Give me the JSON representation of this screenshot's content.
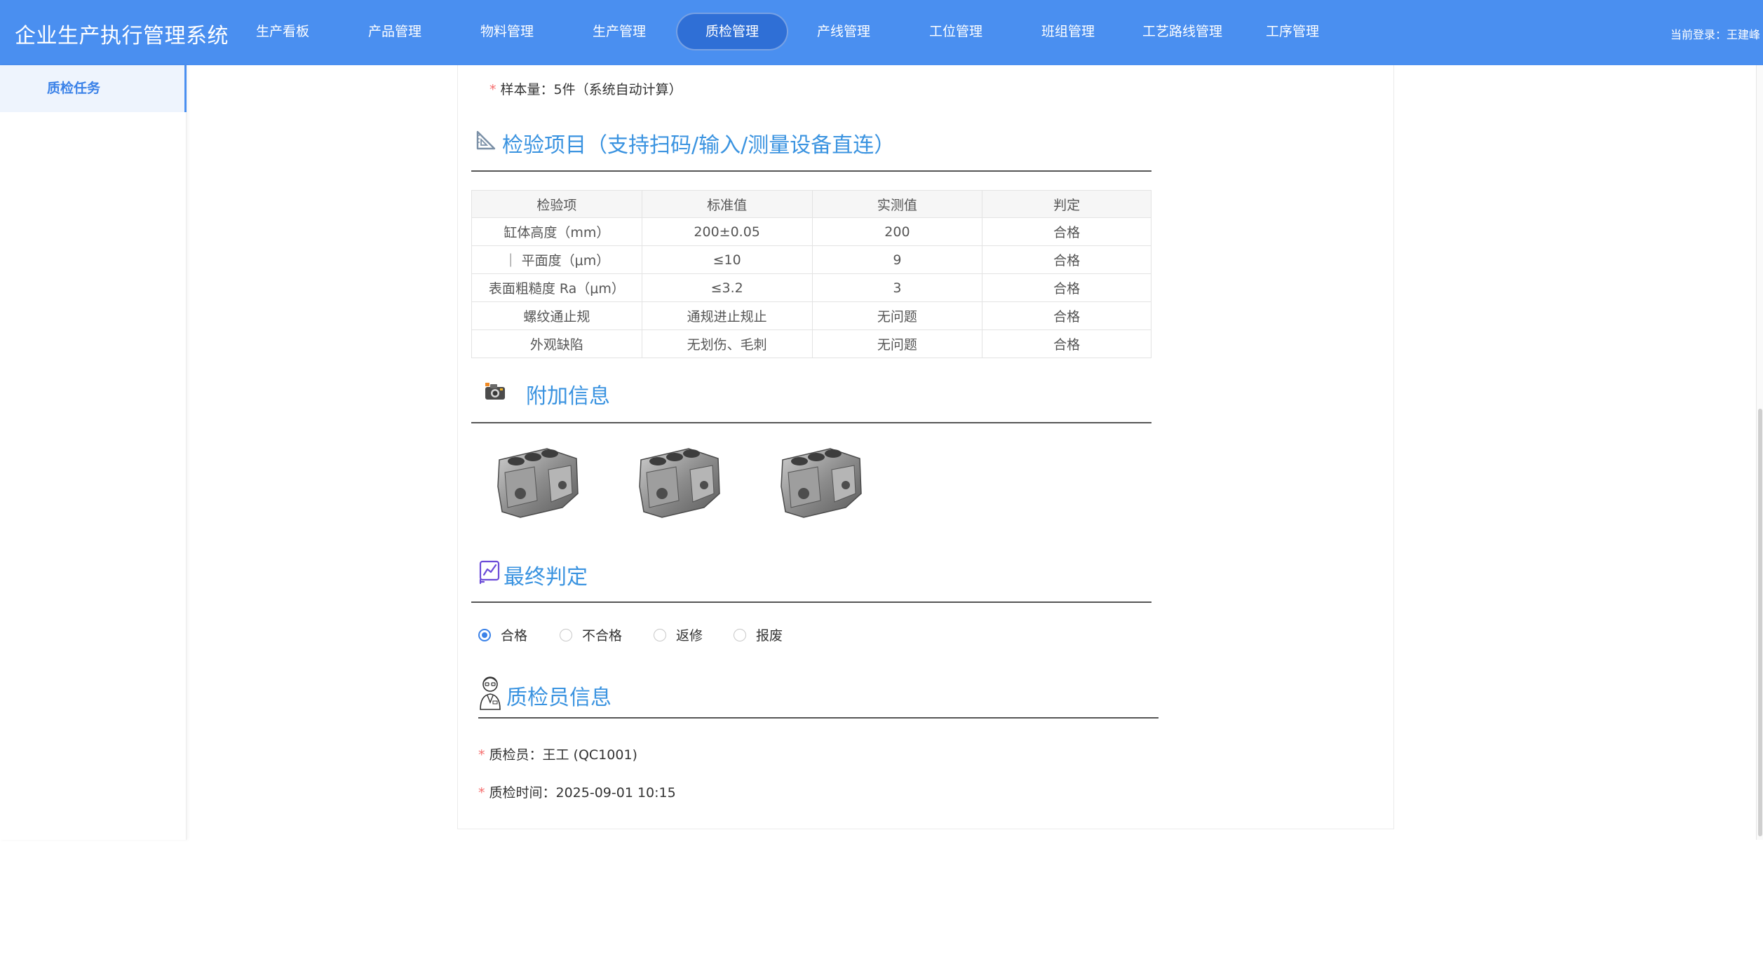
{
  "header": {
    "app_title": "企业生产执行管理系统",
    "nav": [
      {
        "label": "生产看板"
      },
      {
        "label": "产品管理"
      },
      {
        "label": "物料管理"
      },
      {
        "label": "生产管理"
      },
      {
        "label": "质检管理",
        "active": true
      },
      {
        "label": "产线管理"
      },
      {
        "label": "工位管理"
      },
      {
        "label": "班组管理"
      },
      {
        "label": "工艺路线管理"
      },
      {
        "label": "工序管理"
      }
    ],
    "user": "当前登录：王建峰"
  },
  "sidebar": {
    "items": [
      {
        "label": "质检任务",
        "active": true
      }
    ]
  },
  "sample": {
    "label": "样本量：5件（系统自动计算）"
  },
  "inspection": {
    "title": "检验项目（支持扫码/输入/测量设备直连）",
    "icon": "triangle-ruler-icon",
    "columns": [
      "检验项",
      "标准值",
      "实测值",
      "判定"
    ],
    "rows": [
      [
        "缸体高度（mm）",
        "200±0.05",
        "200",
        "合格"
      ],
      [
        "｜ 平面度（μm）",
        "≤10",
        "9",
        "合格"
      ],
      [
        "表面粗糙度 Ra（μm）",
        "≤3.2",
        "3",
        "合格"
      ],
      [
        "螺纹通止规",
        "通规进止规止",
        "无问题",
        "合格"
      ],
      [
        "外观缺陷",
        "无划伤、毛刺",
        "无问题",
        "合格"
      ]
    ]
  },
  "attachments": {
    "title": "附加信息",
    "icon": "camera-icon",
    "images": [
      "engine-block-image",
      "engine-block-image",
      "engine-block-image"
    ]
  },
  "final": {
    "title": "最终判定",
    "icon": "trend-chart-icon",
    "options": [
      {
        "label": "合格",
        "checked": true
      },
      {
        "label": "不合格",
        "checked": false
      },
      {
        "label": "返修",
        "checked": false
      },
      {
        "label": "报废",
        "checked": false
      }
    ]
  },
  "inspector": {
    "title": "质检员信息",
    "icon": "inspector-avatar-icon",
    "name": "质检员：王工 (QC1001)",
    "time": "质检时间：2025-09-01 10:15"
  },
  "colors": {
    "header_bg": "#4a8ff0",
    "accent": "#3b82e8",
    "section_title": "#3a93e0",
    "required": "#f56c6c"
  }
}
